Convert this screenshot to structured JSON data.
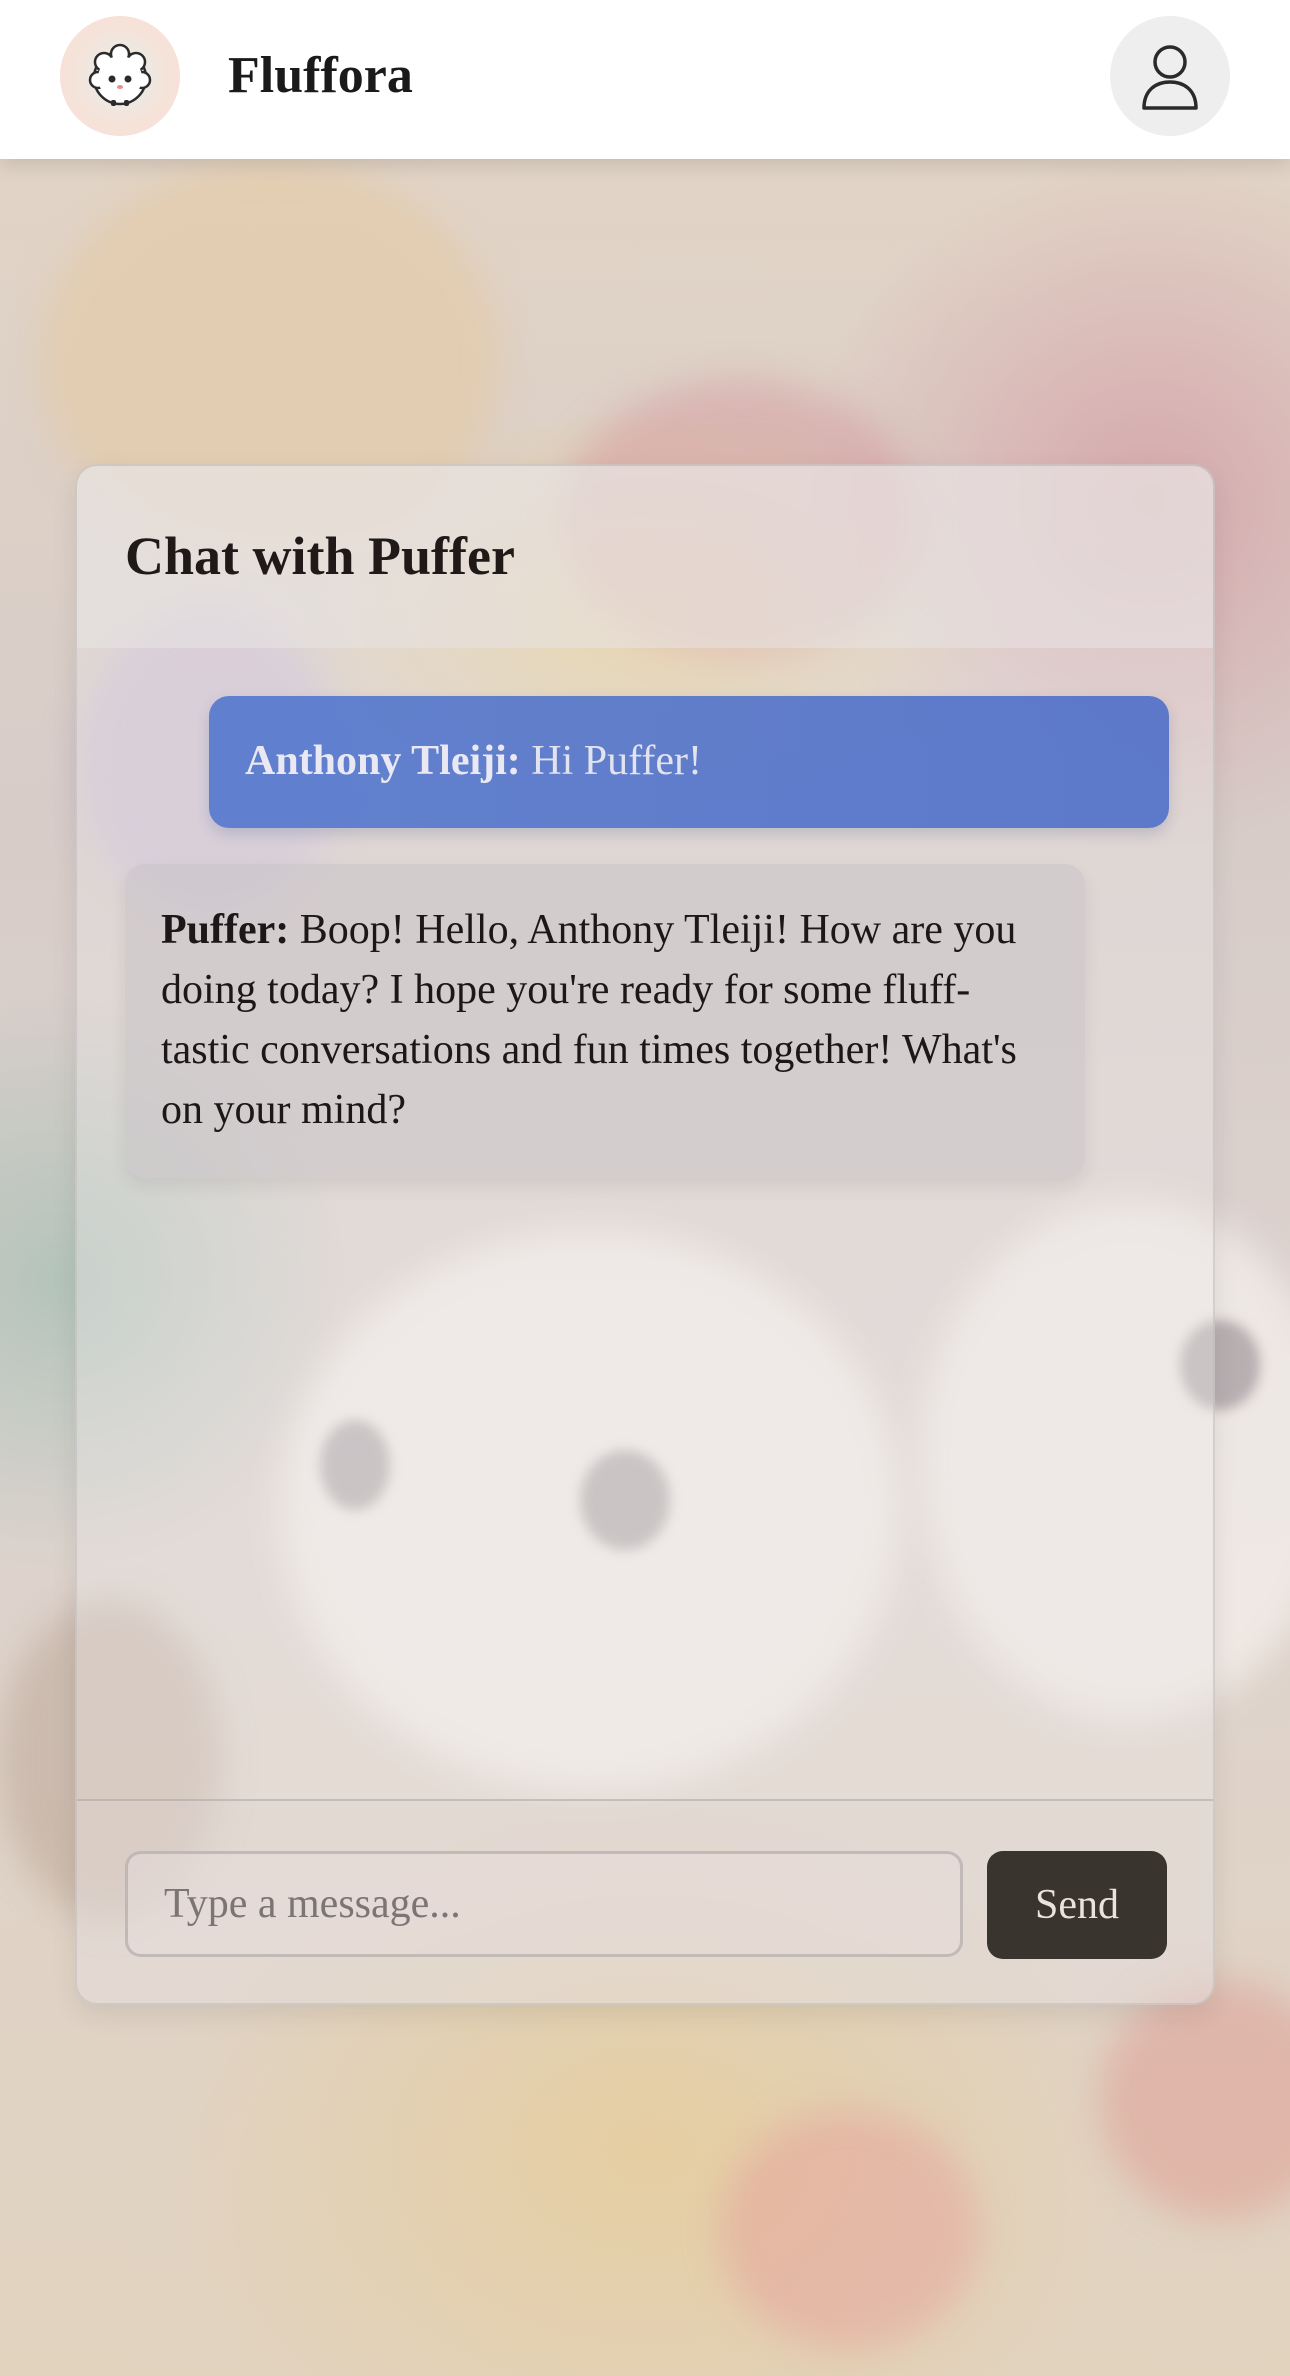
{
  "app": {
    "title": "Fluffora",
    "logo_icon": "fluffy-creature-logo-icon",
    "profile_icon": "user-profile-icon"
  },
  "chat": {
    "title": "Chat with Puffer",
    "messages": [
      {
        "sender": "Anthony Tleiji:",
        "text": " Hi Puffer!",
        "role": "user"
      },
      {
        "sender": "Puffer:",
        "text": " Boop! Hello, Anthony Tleiji! How are you doing today? I hope you're ready for some fluff-tastic conversations and fun times together! What's on your mind?",
        "role": "bot"
      }
    ]
  },
  "composer": {
    "placeholder": "Type a message...",
    "value": "",
    "send_label": "Send"
  },
  "colors": {
    "user_bubble": "#466ecd",
    "send_button": "#3a342e",
    "header_bg": "#ffffff"
  }
}
